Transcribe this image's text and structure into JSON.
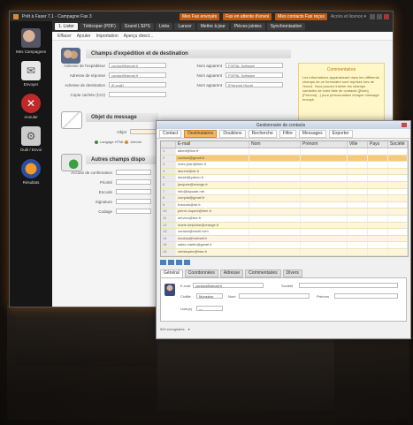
{
  "colors": {
    "accent": "#b85a14",
    "selection": "#f4b860",
    "info_bg": "#fff7c8"
  },
  "main_window": {
    "title": "Prêt à Faxer 7.1 - Campagne Fax 3",
    "title_buttons": [
      "Mes Fax envoyés",
      "Fax en attente d'envoi",
      "Mes contacts Fax reçus"
    ],
    "title_right": "Accès et licence ▾",
    "left_nav": [
      {
        "label": "Mes Campagnes",
        "icon": "campaigns-icon"
      },
      {
        "label": "Envoyer",
        "icon": "envelope-icon"
      },
      {
        "label": "Annuler",
        "icon": "cancel-icon"
      },
      {
        "label": "Outil / Envoi",
        "icon": "tools-icon"
      },
      {
        "label": "Résultats",
        "icon": "browser-icon"
      }
    ],
    "tabs": [
      "1. Lister",
      "Télécoper (PDF)",
      "Grand L'EPS",
      "Links",
      "Lancer",
      "Mettre à jour",
      "Pièces jointes",
      "Synchronisation"
    ],
    "subbar": [
      "Effacer",
      "Ajouter",
      "Importation",
      "Aperçu direct..."
    ],
    "section1_title": "Champs d'expédition et de destination",
    "section1_fields": [
      {
        "label": "Adresse de l'expéditeur",
        "value": "contact@gmail.fr",
        "right_label": "Nom apparent",
        "right_value": "FIXPAL Software"
      },
      {
        "label": "Adresse de réponse",
        "value": "contact@gmail.fr",
        "right_label": "Nom apparent",
        "right_value": "FIXPAL Software"
      },
      {
        "label": "Adresse de destination",
        "value": "[E-mail]",
        "right_label": "Nom apparent",
        "right_value": "[Prénom] [Nom]"
      },
      {
        "label": "Copie cachée (CCI)",
        "value": "",
        "right_label": "",
        "right_value": ""
      }
    ],
    "section2_title": "Objet du message",
    "section2_fields": [
      {
        "label": "Objet",
        "value": ""
      }
    ],
    "section2_options": [
      "Langage HTML",
      "Joindre"
    ],
    "section3_title": "Autres champs dispo",
    "section3_fields": [
      {
        "label": "Accusé de confirmation",
        "value": ""
      },
      {
        "label": "Priorité",
        "value": ""
      },
      {
        "label": "Encode",
        "value": ""
      },
      {
        "label": "Signature",
        "value": ""
      },
      {
        "label": "Codage",
        "value": ""
      }
    ],
    "infobox": {
      "title": "Commentaires",
      "text": "Les informations apparaissant dans les différents champs de ce formulaire sont reprises lors de l'envoi. Vous pouvez insérer les champs variables de votre liste de contacts ([Nom], [Prénom]...) pour personnaliser chaque message envoyé."
    }
  },
  "dialog": {
    "title": "Gestionnaire de contacts",
    "tools": [
      "Contact",
      "Destinataires",
      "Doublons",
      "Recherche",
      "Filtre",
      "Messages",
      "Exporter"
    ],
    "columns": [
      "",
      "E-mail",
      "Nom",
      "Prénom",
      "Ville",
      "Pays",
      "Société"
    ],
    "rows": [
      {
        "num": "1",
        "email": "albert@live.fr"
      },
      {
        "num": "2",
        "email": "contact@gmail.fr"
      },
      {
        "num": "3",
        "email": "marc.jean@free.fr"
      },
      {
        "num": "4",
        "email": "laurent@sfr.fr"
      },
      {
        "num": "5",
        "email": "daniel@yahoo.fr"
      },
      {
        "num": "6",
        "email": "jacques@orange.fr"
      },
      {
        "num": "7",
        "email": "info@laposte.net"
      },
      {
        "num": "8",
        "email": "compta@gmail.fr"
      },
      {
        "num": "9",
        "email": "francois@sfr.fr"
      },
      {
        "num": "10",
        "email": "pierre.dupont@free.fr"
      },
      {
        "num": "11",
        "email": "service@live.fr"
      },
      {
        "num": "12",
        "email": "marie.delphine@orange.fr"
      },
      {
        "num": "13",
        "email": "contact@nwell.com"
      },
      {
        "num": "14",
        "email": "nicolas@hotmail.fr"
      },
      {
        "num": "15",
        "email": "sales.martin@gmail.fr"
      },
      {
        "num": "16",
        "email": "christophe@free.fr"
      },
      {
        "num": "17",
        "email": "robert@sfr.fr"
      },
      {
        "num": "18",
        "email": "aline.dubois@orange.fr"
      },
      {
        "num": "19",
        "email": "jean.luc@live.fr"
      }
    ],
    "selected_row": 1,
    "lower_tabs": [
      "Général",
      "Coordonnées",
      "Adresse",
      "Commentaires",
      "Divers"
    ],
    "contact": {
      "email_label": "E-mail",
      "email_value": "contact@gmail.fr",
      "society_label": "Société",
      "civility_label": "Civilité",
      "civility_value": "Monsieur",
      "name_label": "Nom",
      "firstname_label": "Prénom",
      "list_label": "Liste(s)",
      "list_value": "—"
    },
    "status": "500 enregistrés"
  }
}
